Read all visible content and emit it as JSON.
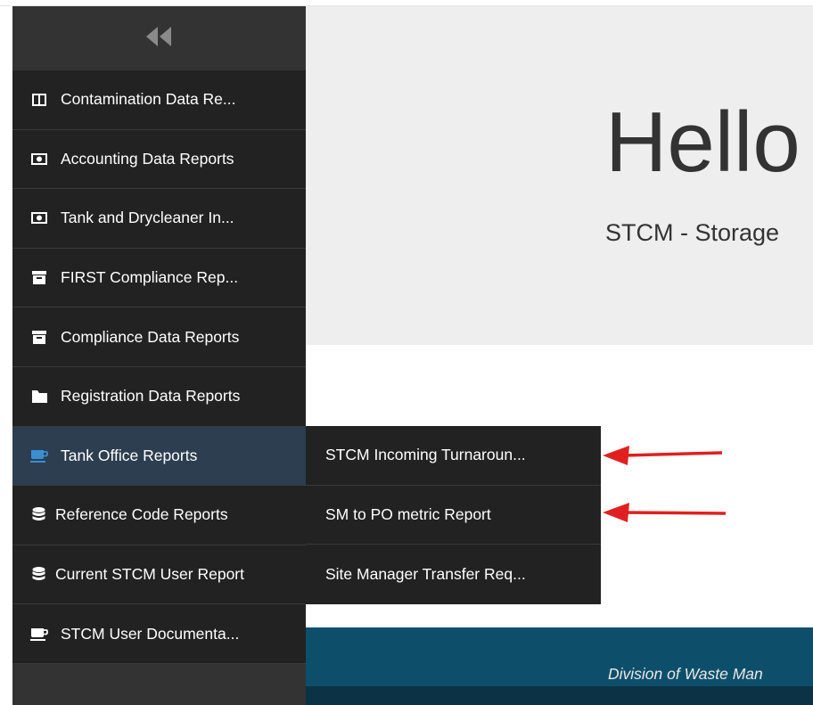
{
  "sidebar": {
    "collapse_icon": "double-chevron-left-icon",
    "items": [
      {
        "label": "Contamination Data Re...",
        "icon": "columns-icon"
      },
      {
        "label": "Accounting Data Reports",
        "icon": "money-icon"
      },
      {
        "label": "Tank and Drycleaner In...",
        "icon": "money-icon"
      },
      {
        "label": "FIRST Compliance Rep...",
        "icon": "archive-icon"
      },
      {
        "label": "Compliance Data Reports",
        "icon": "archive-icon"
      },
      {
        "label": "Registration Data Reports",
        "icon": "folder-icon"
      },
      {
        "label": "Tank Office Reports",
        "icon": "coffee-icon",
        "active": true
      },
      {
        "label": "Reference Code Reports",
        "icon": "database-icon"
      },
      {
        "label": "Current STCM User Report",
        "icon": "database-icon"
      },
      {
        "label": "STCM User Documenta...",
        "icon": "coffee-icon"
      }
    ]
  },
  "submenu": {
    "items": [
      {
        "label": "STCM Incoming Turnaroun..."
      },
      {
        "label": "SM to PO metric Report"
      },
      {
        "label": "Site Manager Transfer Req..."
      }
    ]
  },
  "hero": {
    "title": "Hello",
    "subtitle": "STCM - Storage"
  },
  "footer": {
    "text": "Division of Waste Man"
  },
  "colors": {
    "sidebar_bg": "#222222",
    "active_bg": "#2c3e50",
    "accent_blue": "#3a8fd0",
    "hero_bg": "#eeeeee",
    "footer_bg": "#0d4f6b",
    "annotation_arrow": "#e02020"
  }
}
